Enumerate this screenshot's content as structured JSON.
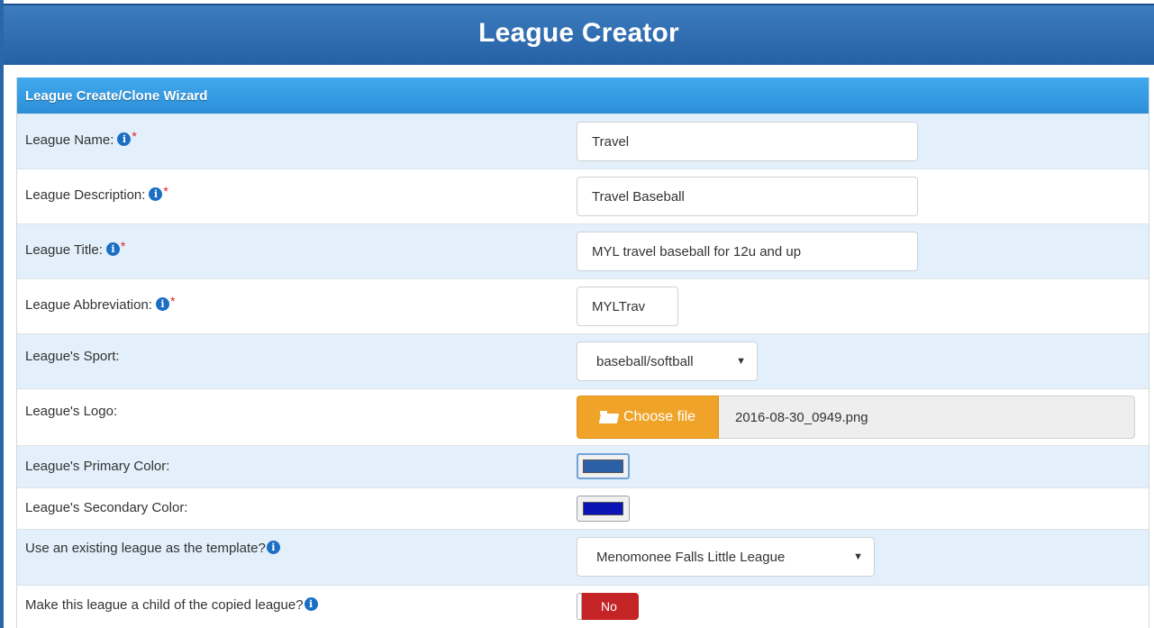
{
  "header": {
    "title": "League Creator"
  },
  "panel": {
    "heading": "League Create/Clone Wizard"
  },
  "fields": {
    "league_name": {
      "label": "League Name:",
      "value": "Travel"
    },
    "league_description": {
      "label": "League Description:",
      "value": "Travel Baseball"
    },
    "league_title": {
      "label": "League Title:",
      "value": "MYL travel baseball for 12u and up"
    },
    "league_abbreviation": {
      "label": "League Abbreviation:",
      "value": "MYLTrav"
    },
    "league_sport": {
      "label": "League's Sport:",
      "selected": "baseball/softball"
    },
    "league_logo": {
      "label": "League's Logo:",
      "button_label": "Choose file",
      "file_name": "2016-08-30_0949.png"
    },
    "primary_color": {
      "label": "League's Primary Color:",
      "value": "#2b5fa6"
    },
    "secondary_color": {
      "label": "League's Secondary Color:",
      "value": "#0a14b4"
    },
    "template_league": {
      "label": "Use an existing league as the template?",
      "selected": "Menomonee Falls Little League"
    },
    "child_league": {
      "label": "Make this league a child of the copied league?",
      "toggle_label": "No"
    }
  },
  "required_marker": "*",
  "info_glyph": "i",
  "dropdown_caret": "▼",
  "colors": {
    "header_bg": "#2e6db0",
    "panel_heading_bg": "#3a9de4",
    "row_alt_bg": "#e3effa",
    "choose_button_bg": "#f0a329",
    "toggle_off_bg": "#c52427",
    "required_red": "#d9242b"
  },
  "icons": [
    "info-icon",
    "folder-open-icon",
    "dropdown-caret-icon"
  ]
}
